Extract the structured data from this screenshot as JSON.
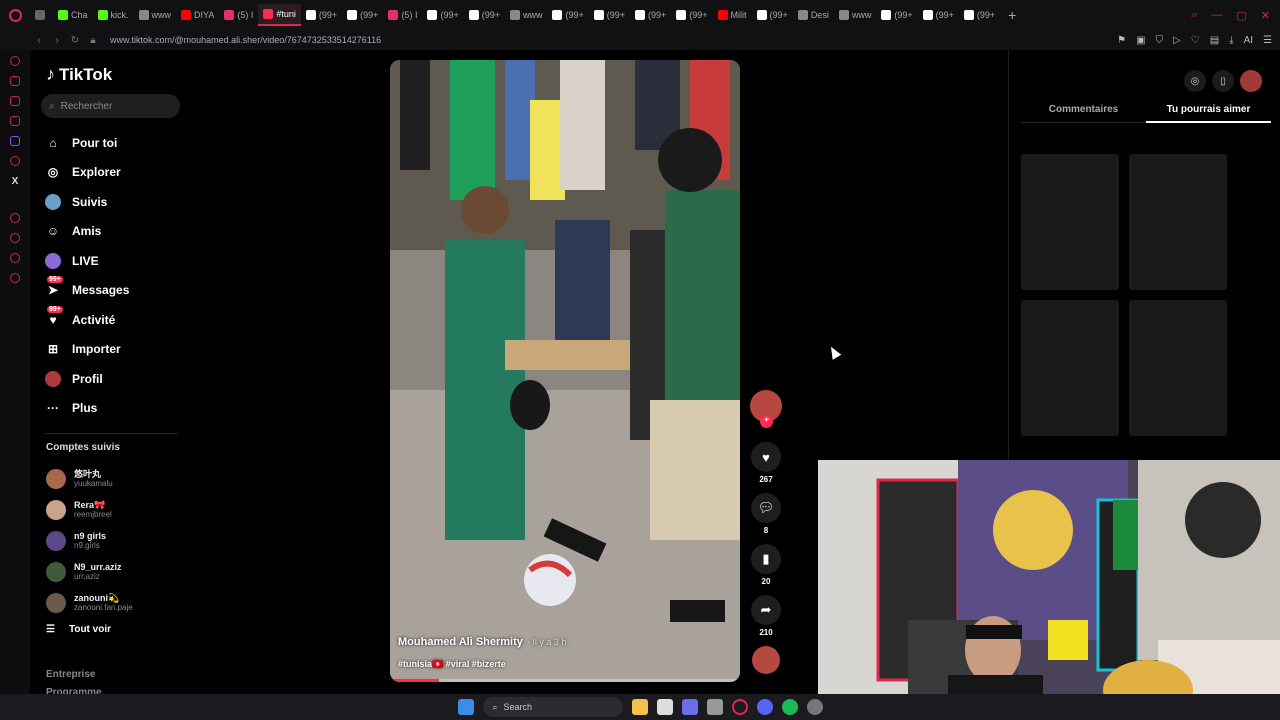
{
  "browser": {
    "tabs": [
      {
        "label": "",
        "color": "#666"
      },
      {
        "label": "Cha",
        "color": "#53fc18"
      },
      {
        "label": "kick.",
        "color": "#53fc18"
      },
      {
        "label": "www",
        "color": "#888"
      },
      {
        "label": "DIYA",
        "color": "#ff0000"
      },
      {
        "label": "(5) I",
        "color": "#e1306c"
      },
      {
        "label": "#tuni",
        "color": "#fe2c55",
        "active": true
      },
      {
        "label": "(99+",
        "color": "#fff"
      },
      {
        "label": "(99+",
        "color": "#fff"
      },
      {
        "label": "(5) I",
        "color": "#e1306c"
      },
      {
        "label": "(99+",
        "color": "#fff"
      },
      {
        "label": "(99+",
        "color": "#fff"
      },
      {
        "label": "www",
        "color": "#888"
      },
      {
        "label": "(99+",
        "color": "#fff"
      },
      {
        "label": "(99+",
        "color": "#fff"
      },
      {
        "label": "(99+",
        "color": "#fff"
      },
      {
        "label": "(99+",
        "color": "#fff"
      },
      {
        "label": "Milit",
        "color": "#ff0000"
      },
      {
        "label": "(99+",
        "color": "#fff"
      },
      {
        "label": "Desi",
        "color": "#888"
      },
      {
        "label": "www",
        "color": "#888"
      },
      {
        "label": "(99+",
        "color": "#fff"
      },
      {
        "label": "(99+",
        "color": "#fff"
      },
      {
        "label": "(99+",
        "color": "#fff"
      }
    ],
    "url": "www.tiktok.com/@mouhamed.ali.sher/video/7674732533514276116",
    "ai_label": "AI"
  },
  "tiktok": {
    "logo": "TikTok",
    "search_placeholder": "Rechercher",
    "nav": [
      {
        "label": "Pour toi",
        "icon": "home-icon"
      },
      {
        "label": "Explorer",
        "icon": "compass-icon"
      },
      {
        "label": "Suivis",
        "icon": "following-avatar"
      },
      {
        "label": "Amis",
        "icon": "friends-icon"
      },
      {
        "label": "LIVE",
        "icon": "live-avatar"
      },
      {
        "label": "Messages",
        "icon": "messages-icon",
        "badge": "99+"
      },
      {
        "label": "Activité",
        "icon": "activity-icon",
        "badge": "99+"
      },
      {
        "label": "Importer",
        "icon": "upload-icon"
      },
      {
        "label": "Profil",
        "icon": "profile-avatar"
      },
      {
        "label": "Plus",
        "icon": "more-icon"
      }
    ],
    "following_title": "Comptes suivis",
    "following": [
      {
        "name": "悠叶丸",
        "user": "yuukamalu",
        "color": "#a56a4c"
      },
      {
        "name": "Rera🎀",
        "user": "reemjbreel",
        "color": "#c9a48a"
      },
      {
        "name": "n9 girls",
        "user": "n9.girls",
        "color": "#5a4a8a"
      },
      {
        "name": "N9_urr.aziz",
        "user": "urr.aziz",
        "color": "#3f5a3a"
      },
      {
        "name": "zanouni💫",
        "user": "zanouni.fan.paje",
        "color": "#6b5a4a"
      }
    ],
    "see_all": "Tout voir",
    "footer": [
      "Entreprise",
      "Programme"
    ]
  },
  "video": {
    "author": "Mouhamed Ali Shermity",
    "time": "· Il y a 3 h",
    "tags": "#tunisia🇹🇳 #viral #bizerte",
    "progress": 0.14,
    "likes": "267",
    "comments": "8",
    "saves": "20",
    "shares": "210"
  },
  "right_panel": {
    "tabs": [
      "Commentaires",
      "Tu pourrais aimer"
    ],
    "active_tab": 1
  },
  "taskbar": {
    "search": "Search"
  }
}
